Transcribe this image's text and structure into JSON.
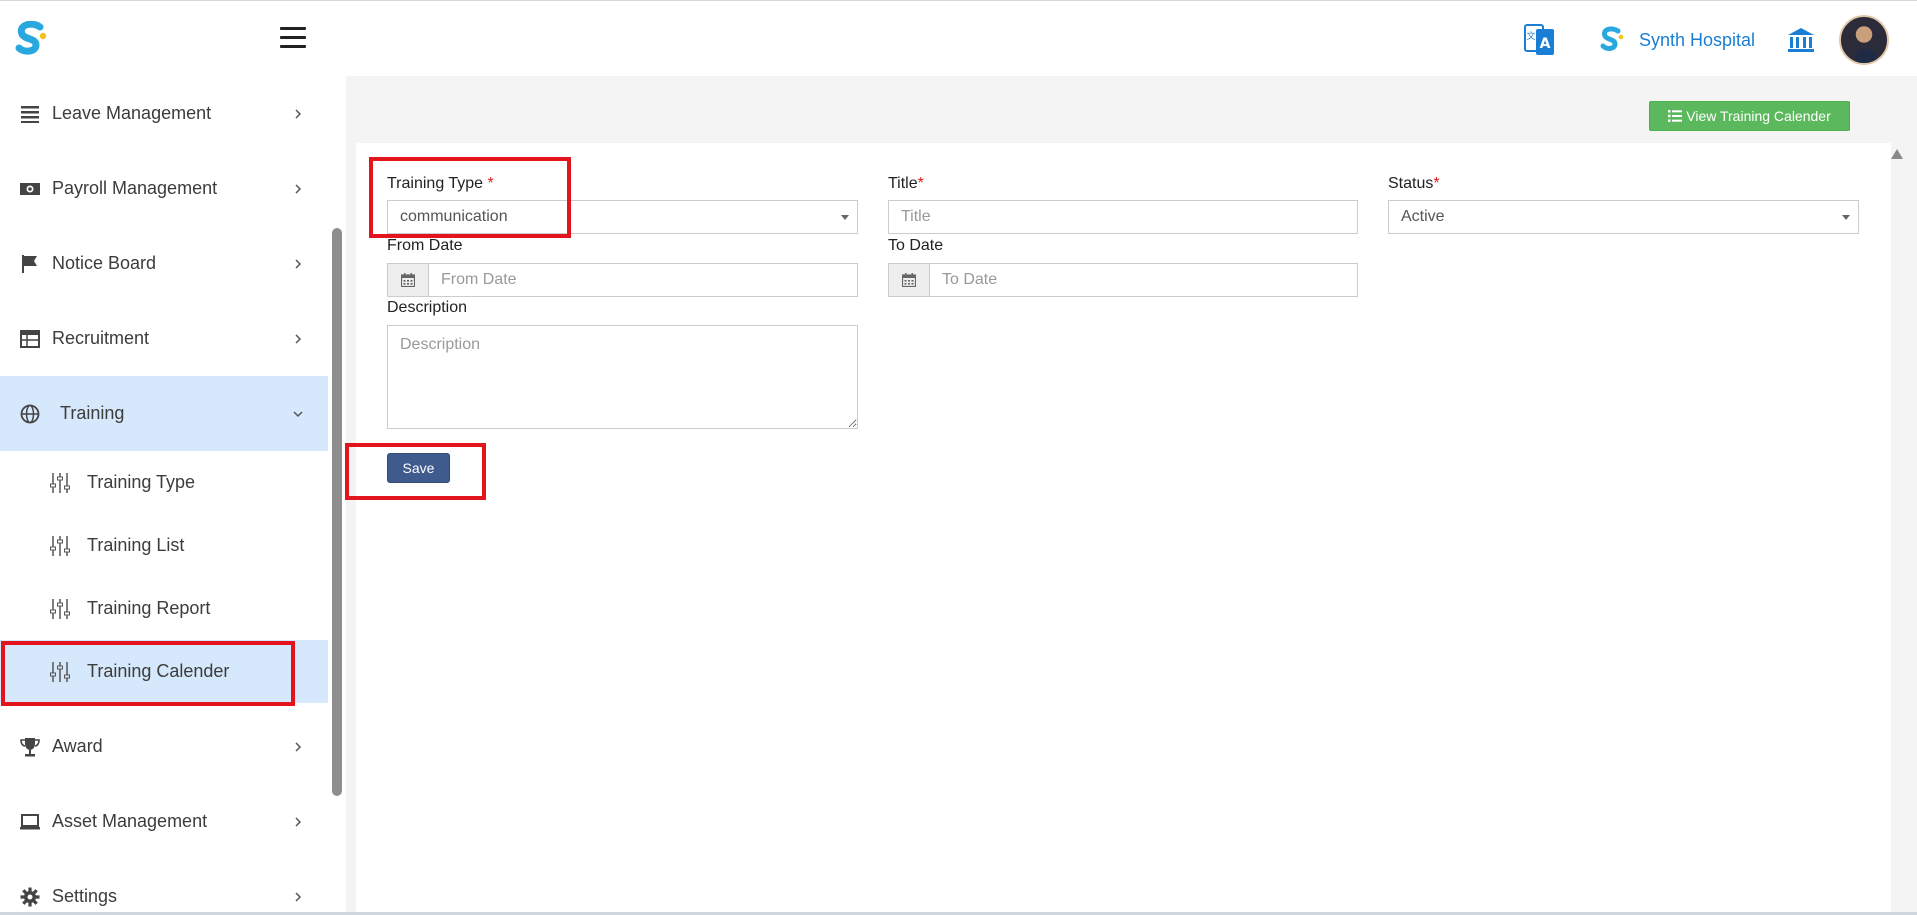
{
  "header": {
    "hospital_name": "Synth Hospital",
    "icons": [
      "app-logo-icon",
      "menu-icon",
      "translate-icon",
      "hospital-logo-icon",
      "bank-icon",
      "user-avatar"
    ]
  },
  "sidebar": {
    "items": [
      {
        "label": "Leave Management",
        "icon": "list-icon"
      },
      {
        "label": "Payroll Management",
        "icon": "money-icon"
      },
      {
        "label": "Notice Board",
        "icon": "flag-icon"
      },
      {
        "label": "Recruitment",
        "icon": "table-icon"
      },
      {
        "label": "Training",
        "icon": "globe-icon",
        "expanded": true
      },
      {
        "label": "Award",
        "icon": "trophy-icon"
      },
      {
        "label": "Asset Management",
        "icon": "laptop-icon"
      },
      {
        "label": "Settings",
        "icon": "gear-icon"
      }
    ],
    "training_sub": [
      {
        "label": "Training Type"
      },
      {
        "label": "Training List"
      },
      {
        "label": "Training Report"
      },
      {
        "label": "Training Calender",
        "active": true
      }
    ]
  },
  "toolbar": {
    "view_calendar_label": "View Training Calender"
  },
  "form": {
    "training_type": {
      "label": "Training Type",
      "required_mark": "*",
      "value": "communication"
    },
    "title": {
      "label": "Title",
      "required_mark": "*",
      "placeholder": "Title"
    },
    "status": {
      "label": "Status",
      "required_mark": "*",
      "value": "Active"
    },
    "from_date": {
      "label": "From Date",
      "placeholder": "From Date"
    },
    "to_date": {
      "label": "To Date",
      "placeholder": "To Date"
    },
    "description": {
      "label": "Description",
      "placeholder": "Description"
    },
    "save_label": "Save"
  },
  "colors": {
    "accent_blue": "#1a7fd4",
    "active_bg": "#d6e8fb",
    "success_green": "#5cb85c",
    "save_blue": "#3f5a8c",
    "highlight_red": "#e3141b",
    "required_red": "#e01f1f"
  }
}
